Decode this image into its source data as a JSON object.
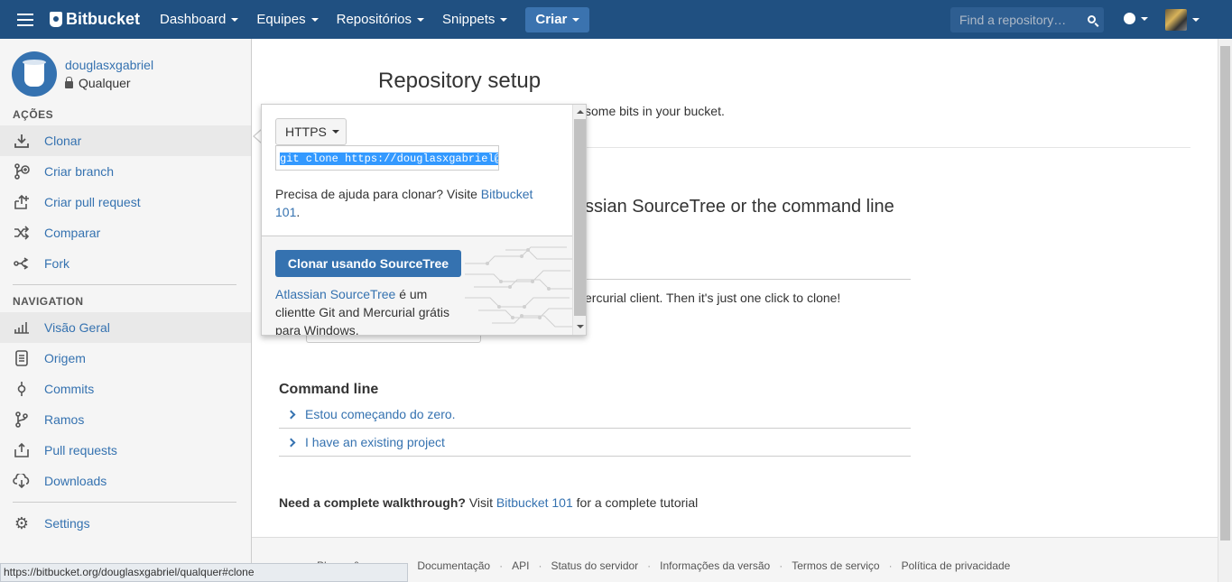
{
  "header": {
    "brand": "Bitbucket",
    "nav": [
      "Dashboard",
      "Equipes",
      "Repositórios",
      "Snippets"
    ],
    "create_label": "Criar",
    "search_placeholder": "Find a repository…"
  },
  "sidebar": {
    "owner": "douglasxgabriel",
    "repo": "Qualquer",
    "actions_title": "AÇÕES",
    "actions": [
      {
        "label": "Clonar",
        "icon": "download-icon"
      },
      {
        "label": "Criar branch",
        "icon": "branch-icon"
      },
      {
        "label": "Criar pull request",
        "icon": "pull-request-icon"
      },
      {
        "label": "Comparar",
        "icon": "compare-icon"
      },
      {
        "label": "Fork",
        "icon": "fork-icon"
      }
    ],
    "navigation_title": "NAVIGATION",
    "navigation": [
      {
        "label": "Visão Geral",
        "icon": "overview-icon"
      },
      {
        "label": "Origem",
        "icon": "source-icon"
      },
      {
        "label": "Commits",
        "icon": "commit-icon"
      },
      {
        "label": "Ramos",
        "icon": "branches-icon"
      },
      {
        "label": "Pull requests",
        "icon": "pull-requests-icon"
      },
      {
        "label": "Downloads",
        "icon": "cloud-download-icon"
      }
    ],
    "settings_label": "Settings",
    "status_url": "https://bitbucket.org/douglasxgabriel/qualquer#clone"
  },
  "main": {
    "title": "Repository setup",
    "intro": "some bits in your bucket.",
    "heading_partial": "ssian SourceTree or the command line",
    "client_text": "ercurial client. Then it's just one click to clone!",
    "cmd_title": "Command line",
    "cmd_rows": [
      "Estou começando do zero.",
      "I have an existing project"
    ],
    "walk_bold": "Need a complete walkthrough?",
    "walk_visit": " Visit ",
    "walk_link": "Bitbucket 101",
    "walk_tail": " for a complete tutorial",
    "footer_links": [
      "Planos & preços",
      "Documentação",
      "API",
      "Status do servidor",
      "Informações da versão",
      "Termos de serviço",
      "Política de privacidade"
    ]
  },
  "popup": {
    "protocol": "HTTPS",
    "clone_command": "git clone https://douglasxgabriel@bi",
    "help_text": "Precisa de ajuda para clonar? Visite ",
    "help_link": "Bitbucket 101",
    "help_tail": ".",
    "sourcetree_button": "Clonar usando SourceTree",
    "st_link": "Atlassian SourceTree",
    "st_text": " é um clientte Git and Mercurial grátis para Windows."
  }
}
